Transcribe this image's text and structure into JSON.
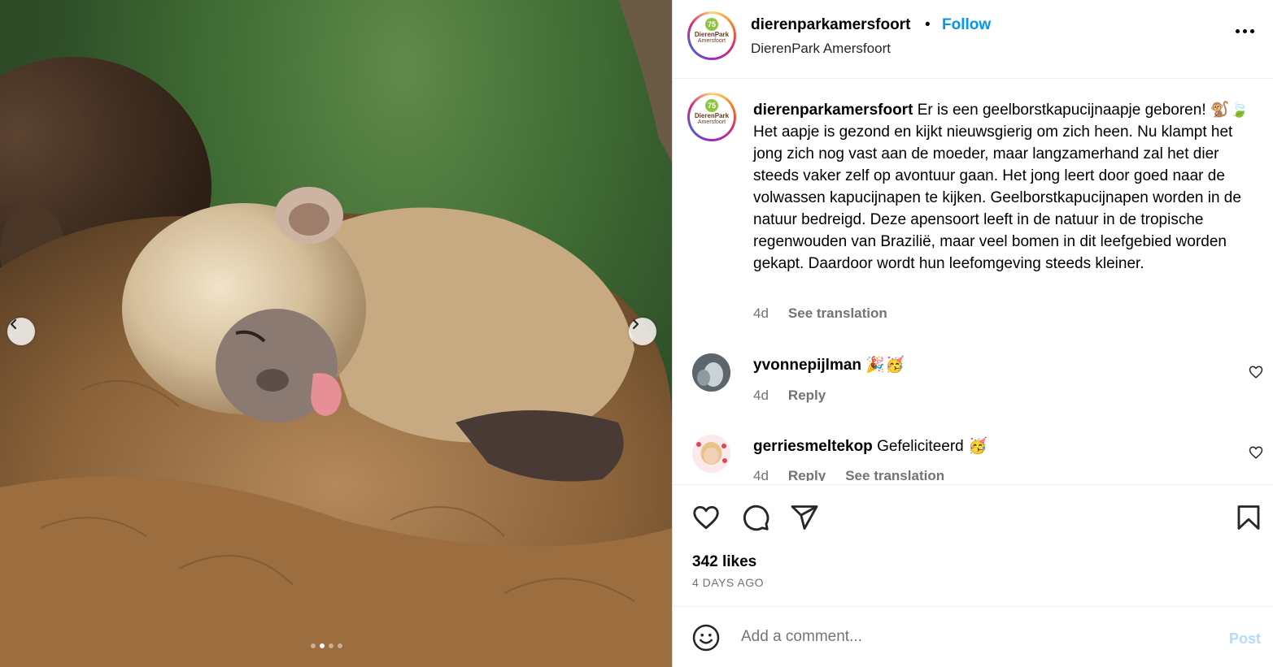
{
  "post": {
    "username": "dierenparkamersfoort",
    "separator": "•",
    "follow_label": "Follow",
    "location": "DierenPark Amersfoort",
    "logo_number": "75",
    "logo_line1": "DierenPark",
    "logo_line2": "Amersfoort"
  },
  "caption": {
    "username": "dierenparkamersfoort",
    "text": "Er is een geelborstkapucijnaapje geboren! 🐒🍃 Het aapje is gezond en kijkt nieuwsgierig om zich heen. Nu klampt het jong zich nog vast aan de moeder, maar langzamerhand zal het dier steeds vaker zelf op avontuur gaan. Het jong leert door goed naar de volwassen kapucijnapen te kijken. Geelborstkapucijnapen worden in de natuur bedreigd. Deze apensoort leeft in de natuur in de tropische regenwouden van Brazilië, maar veel bomen in dit leefgebied worden gekapt. Daardoor wordt hun leefomgeving steeds kleiner.",
    "time": "4d",
    "translate": "See translation"
  },
  "comments": [
    {
      "username": "yvonnepijlman",
      "text": "🎉🥳",
      "time": "4d",
      "reply": "Reply",
      "translate": ""
    },
    {
      "username": "gerriesmeltekop",
      "text": "Gefeliciteerd 🥳",
      "time": "4d",
      "reply": "Reply",
      "translate": "See translation"
    }
  ],
  "likes": "342 likes",
  "date": "4 DAYS AGO",
  "add_comment": {
    "placeholder": "Add a comment...",
    "post_label": "Post"
  },
  "carousel": {
    "count": 4,
    "active_index": 1
  },
  "colors": {
    "accent": "#0095f6",
    "post_disabled": "#b3dbff",
    "muted": "#737373"
  },
  "icons": [
    "chevron-left-icon",
    "chevron-right-icon",
    "more-icon",
    "heart-icon",
    "comment-icon",
    "share-icon",
    "bookmark-icon",
    "emoji-icon"
  ]
}
